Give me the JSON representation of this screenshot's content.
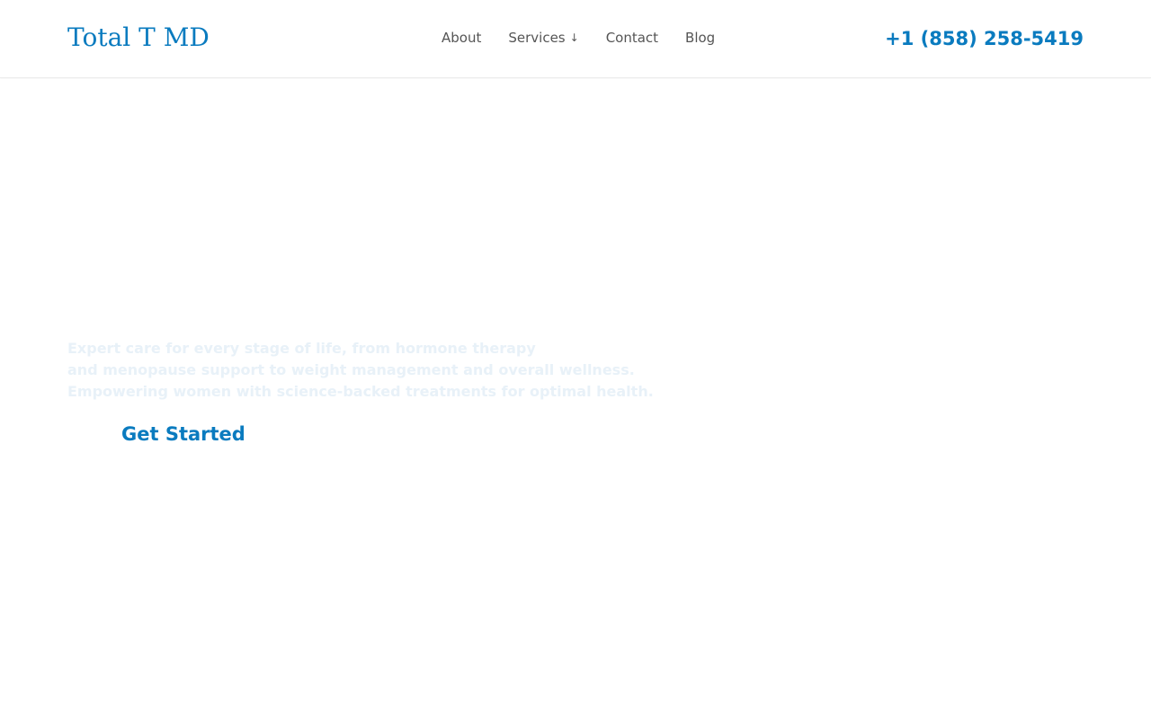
{
  "header": {
    "logo_text": "Total T MD",
    "nav": [
      {
        "label": "About"
      },
      {
        "label": "Services",
        "chevron": "↓"
      },
      {
        "label": "Contact"
      },
      {
        "label": "Blog"
      }
    ],
    "phone": "+1 (858) 258-5419"
  },
  "hero": {
    "lines": [
      "Expert care for every stage of life, from hormone therapy",
      "and menopause support to weight management and overall wellness.",
      "Empowering women with science-backed treatments for optimal health."
    ],
    "cta_label": "Get Started"
  },
  "colors": {
    "brand": "#0a7bbf",
    "nav_text": "#555555",
    "hero_text": "#e8f1f8",
    "background": "#ffffff"
  },
  "icons": {
    "services_dropdown": "arrow-down-icon"
  }
}
